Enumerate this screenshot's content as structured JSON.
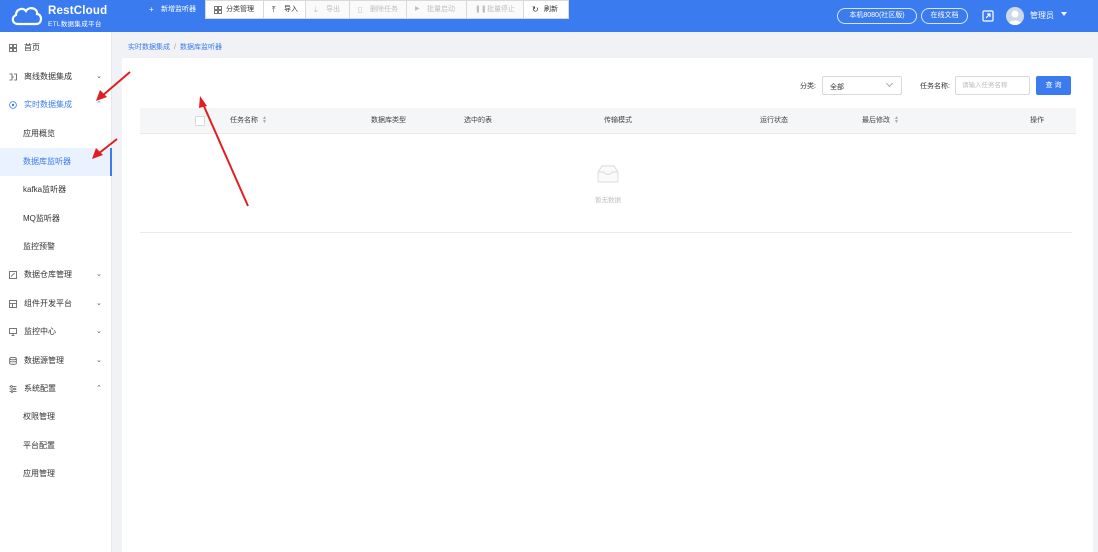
{
  "header": {
    "logo_title": "RestCloud",
    "logo_subtitle": "ETL数据集成平台",
    "machine_label": "本机8080(社区版)",
    "docs_label": "在线文档",
    "user_name": "管理员"
  },
  "sidebar": {
    "items": [
      {
        "label": "首页",
        "icon": "grid-icon"
      },
      {
        "label": "离线数据集成",
        "icon": "offline-integration-icon",
        "chevron": "⌄"
      },
      {
        "label": "实时数据集成",
        "icon": "realtime-integration-icon",
        "chevron": "⌃"
      },
      {
        "label": "应用概览"
      },
      {
        "label": "数据库监听器"
      },
      {
        "label": "kafka监听器"
      },
      {
        "label": "MQ监听器"
      },
      {
        "label": "监控预警"
      },
      {
        "label": "数据仓库管理",
        "icon": "warehouse-icon",
        "chevron": "⌄"
      },
      {
        "label": "组件开发平台",
        "icon": "component-icon",
        "chevron": "⌄"
      },
      {
        "label": "监控中心",
        "icon": "monitor-icon",
        "chevron": "⌄"
      },
      {
        "label": "数据源管理",
        "icon": "database-icon",
        "chevron": "⌄"
      },
      {
        "label": "系统配置",
        "icon": "settings-icon",
        "chevron": "⌃"
      },
      {
        "label": "权限管理"
      },
      {
        "label": "平台配置"
      },
      {
        "label": "应用管理"
      }
    ]
  },
  "breadcrumb": {
    "parent": "实时数据集成",
    "separator": "/",
    "current": "数据库监听器"
  },
  "toolbar": {
    "new_listener": "新增监听器",
    "category_manage": "分类管理",
    "import": "导入",
    "export": "导出",
    "delete_task": "删除任务",
    "batch_start": "批量启动",
    "batch_stop": "批量停止",
    "refresh": "刷新"
  },
  "filters": {
    "category_label": "分类:",
    "category_value": "全部",
    "task_name_label": "任务名称:",
    "task_name_placeholder": "请输入任务名称",
    "search_button": "查 询"
  },
  "table": {
    "columns": [
      "任务名称",
      "数据库类型",
      "选中的表",
      "传输模式",
      "运行状态",
      "最后修改",
      "操作"
    ],
    "empty_text": "暂无数据"
  },
  "colors": {
    "primary": "#3a7bf0",
    "annotation_arrow": "#e02020"
  }
}
